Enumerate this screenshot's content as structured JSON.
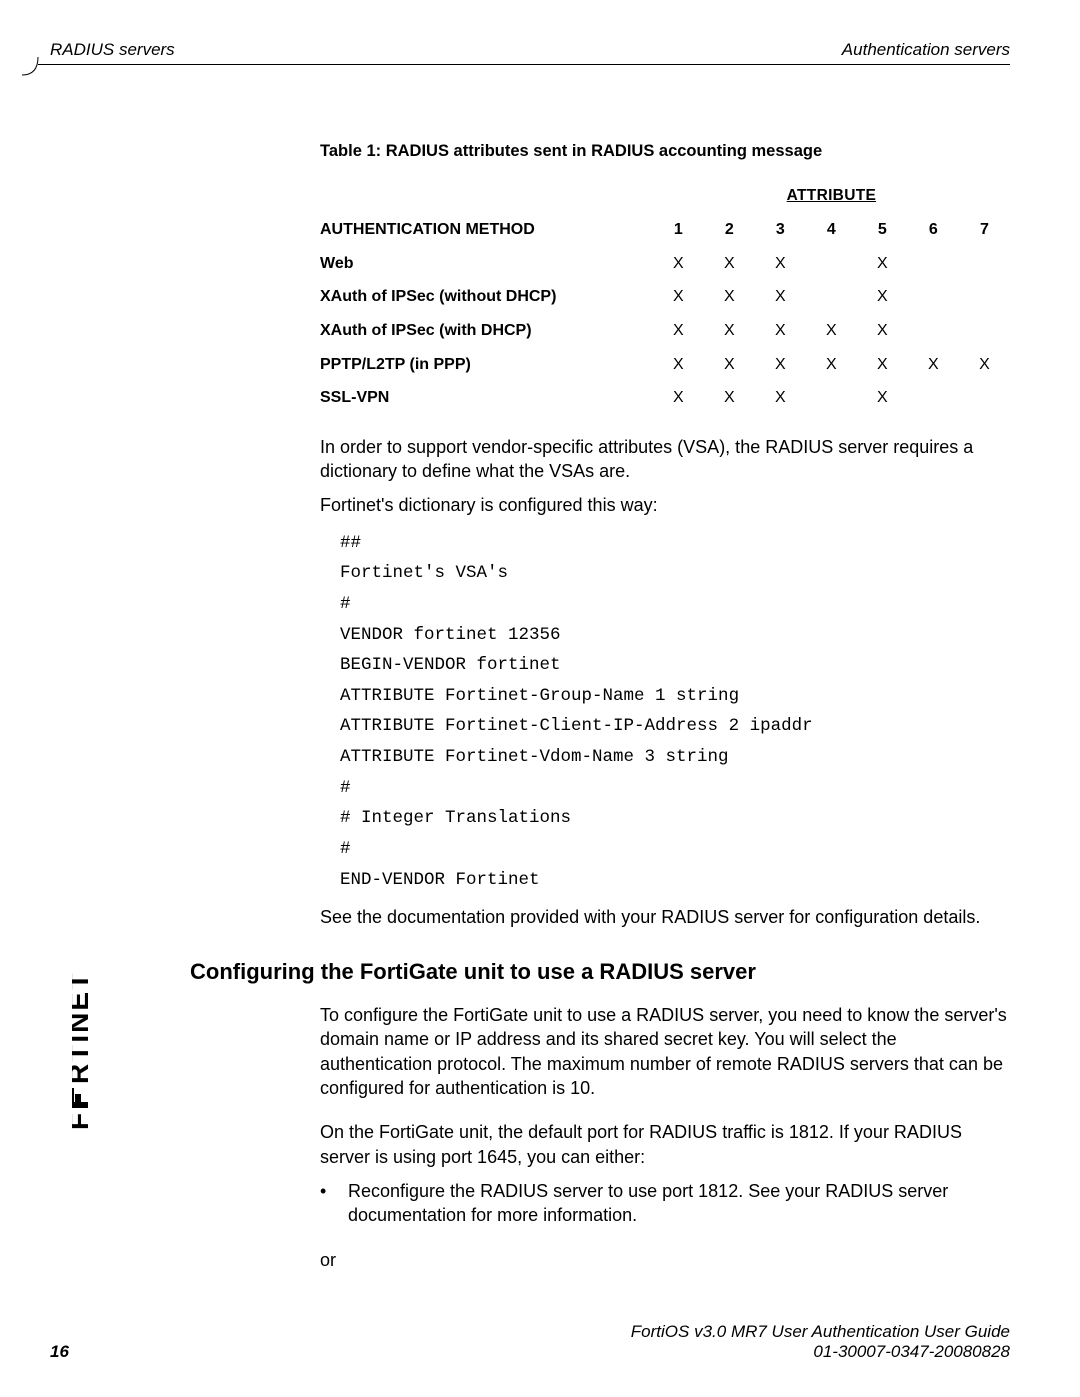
{
  "header": {
    "left": "RADIUS servers",
    "right": "Authentication servers"
  },
  "table": {
    "caption": "Table 1: RADIUS attributes sent in RADIUS accounting message",
    "attribute_label": "ATTRIBUTE",
    "method_label": "AUTHENTICATION METHOD",
    "columns": [
      "1",
      "2",
      "3",
      "4",
      "5",
      "6",
      "7"
    ],
    "rows": [
      {
        "method": "Web",
        "marks": [
          "X",
          "X",
          "X",
          "",
          "X",
          "",
          ""
        ]
      },
      {
        "method": "XAuth of IPSec (without DHCP)",
        "marks": [
          "X",
          "X",
          "X",
          "",
          "X",
          "",
          ""
        ]
      },
      {
        "method": "XAuth of IPSec (with DHCP)",
        "marks": [
          "X",
          "X",
          "X",
          "X",
          "X",
          "",
          ""
        ]
      },
      {
        "method": "PPTP/L2TP (in PPP)",
        "marks": [
          "X",
          "X",
          "X",
          "X",
          "X",
          "X",
          "X"
        ]
      },
      {
        "method": "SSL-VPN",
        "marks": [
          "X",
          "X",
          "X",
          "",
          "X",
          "",
          ""
        ]
      }
    ]
  },
  "chart_data": {
    "type": "table",
    "title": "Table 1: RADIUS attributes sent in RADIUS accounting message",
    "columns": [
      "AUTHENTICATION METHOD",
      "1",
      "2",
      "3",
      "4",
      "5",
      "6",
      "7"
    ],
    "rows": [
      [
        "Web",
        "X",
        "X",
        "X",
        "",
        "X",
        "",
        ""
      ],
      [
        "XAuth of IPSec (without DHCP)",
        "X",
        "X",
        "X",
        "",
        "X",
        "",
        ""
      ],
      [
        "XAuth of IPSec (with DHCP)",
        "X",
        "X",
        "X",
        "X",
        "X",
        "",
        ""
      ],
      [
        "PPTP/L2TP (in PPP)",
        "X",
        "X",
        "X",
        "X",
        "X",
        "X",
        "X"
      ],
      [
        "SSL-VPN",
        "X",
        "X",
        "X",
        "",
        "X",
        "",
        ""
      ]
    ]
  },
  "body": {
    "p1": "In order to support vendor-specific attributes (VSA), the RADIUS server requires a dictionary to define what the VSAs are.",
    "p2": "Fortinet's dictionary is configured this way:",
    "code": "##\nFortinet's VSA's\n#\nVENDOR fortinet 12356\nBEGIN-VENDOR fortinet\nATTRIBUTE Fortinet-Group-Name 1 string\nATTRIBUTE Fortinet-Client-IP-Address 2 ipaddr\nATTRIBUTE Fortinet-Vdom-Name 3 string\n#\n# Integer Translations\n#\nEND-VENDOR Fortinet",
    "p3": "See the documentation provided with your RADIUS server for configuration details."
  },
  "section": {
    "heading": "Configuring the FortiGate unit to use a RADIUS server",
    "p1": "To configure the FortiGate unit to use a RADIUS server, you need to know the server's domain name or IP address and its shared secret key. You will select the authentication protocol. The maximum number of remote RADIUS servers that can be configured for authentication is 10.",
    "p2": "On the FortiGate unit, the default port for RADIUS traffic is 1812. If your RADIUS server is using port 1645, you can either:",
    "bullet1": "Reconfigure the RADIUS server to use port 1812. See your RADIUS server documentation for more information.",
    "or": "or"
  },
  "footer": {
    "page": "16",
    "title": "FortiOS v3.0 MR7 User Authentication User Guide",
    "docnum": "01-30007-0347-20080828"
  }
}
